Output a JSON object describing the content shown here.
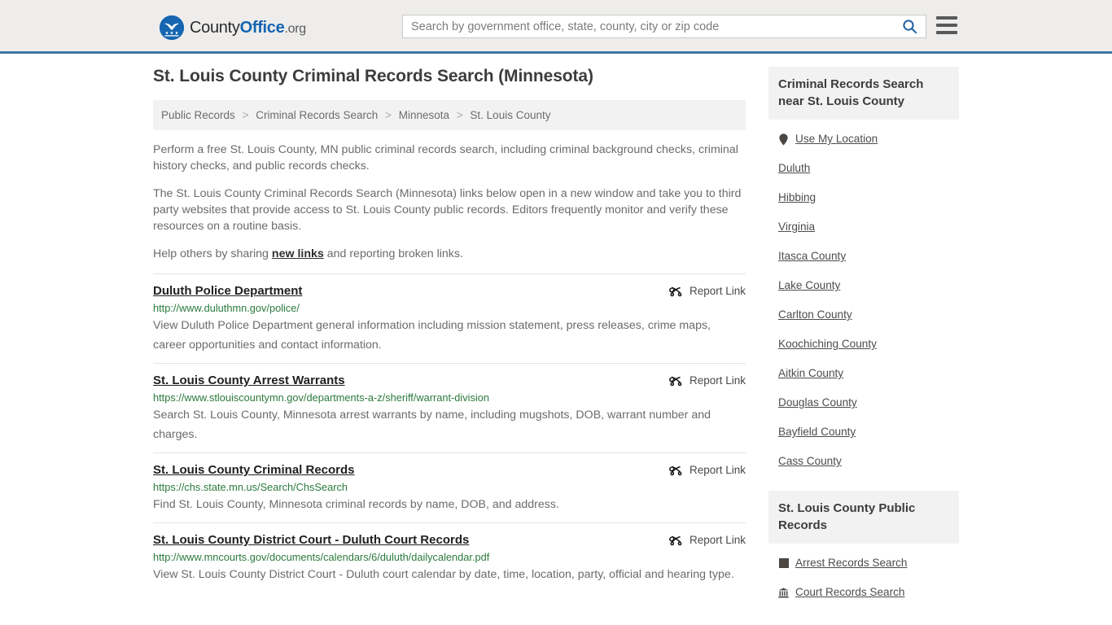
{
  "header": {
    "logo": {
      "icon": "countyoffice-eagle-seal-icon",
      "text_part1": "County",
      "text_part2": "Office",
      "text_tld": ".org"
    },
    "search": {
      "placeholder": "Search by government office, state, county, city or zip code",
      "value": "",
      "search_icon": "search-icon"
    },
    "menu_icon": "hamburger-menu-icon",
    "accent_color": "#3a76a6"
  },
  "main": {
    "title": "St. Louis County Criminal Records Search (Minnesota)",
    "breadcrumb": {
      "separator": ">",
      "items": [
        "Public Records",
        "Criminal Records Search",
        "Minnesota",
        "St. Louis County"
      ]
    },
    "intro": {
      "p1": "Perform a free St. Louis County, MN public criminal records search, including criminal background checks, criminal history checks, and public records checks.",
      "p2": "The St. Louis County Criminal Records Search (Minnesota) links below open in a new window and take you to third party websites that provide access to St. Louis County public records. Editors frequently monitor and verify these resources on a routine basis.",
      "p3_before": "Help others by sharing ",
      "p3_link": "new links",
      "p3_after": " and reporting broken links."
    },
    "report_link_label": "Report Link",
    "report_link_icon": "broken-link-icon",
    "listings": [
      {
        "title": "Duluth Police Department",
        "url": "http://www.duluthmn.gov/police/",
        "description": "View Duluth Police Department general information including mission statement, press releases, crime maps, career opportunities and contact information."
      },
      {
        "title": "St. Louis County Arrest Warrants",
        "url": "https://www.stlouiscountymn.gov/departments-a-z/sheriff/warrant-division",
        "description": "Search St. Louis County, Minnesota arrest warrants by name, including mugshots, DOB, warrant number and charges."
      },
      {
        "title": "St. Louis County Criminal Records",
        "url": "https://chs.state.mn.us/Search/ChsSearch",
        "description": "Find St. Louis County, Minnesota criminal records by name, DOB, and address."
      },
      {
        "title": "St. Louis County District Court - Duluth Court Records",
        "url": "http://www.mncourts.gov/documents/calendars/6/duluth/dailycalendar.pdf",
        "description": "View St. Louis County District Court - Duluth court calendar by date, time, location, party, official and hearing type."
      }
    ]
  },
  "sidebar": {
    "nearby": {
      "heading": "Criminal Records Search near St. Louis County",
      "items": [
        {
          "label": "Use My Location",
          "icon": "map-pin-icon"
        },
        {
          "label": "Duluth",
          "icon": ""
        },
        {
          "label": "Hibbing",
          "icon": ""
        },
        {
          "label": "Virginia",
          "icon": ""
        },
        {
          "label": "Itasca County",
          "icon": ""
        },
        {
          "label": "Lake County",
          "icon": ""
        },
        {
          "label": "Carlton County",
          "icon": ""
        },
        {
          "label": "Koochiching County",
          "icon": ""
        },
        {
          "label": "Aitkin County",
          "icon": ""
        },
        {
          "label": "Douglas County",
          "icon": ""
        },
        {
          "label": "Bayfield County",
          "icon": ""
        },
        {
          "label": "Cass County",
          "icon": ""
        }
      ]
    },
    "public_records": {
      "heading": "St. Louis County Public Records",
      "items": [
        {
          "label": "Arrest Records Search",
          "icon": "arrest-records-icon"
        },
        {
          "label": "Court Records Search",
          "icon": "courthouse-icon"
        }
      ]
    }
  }
}
